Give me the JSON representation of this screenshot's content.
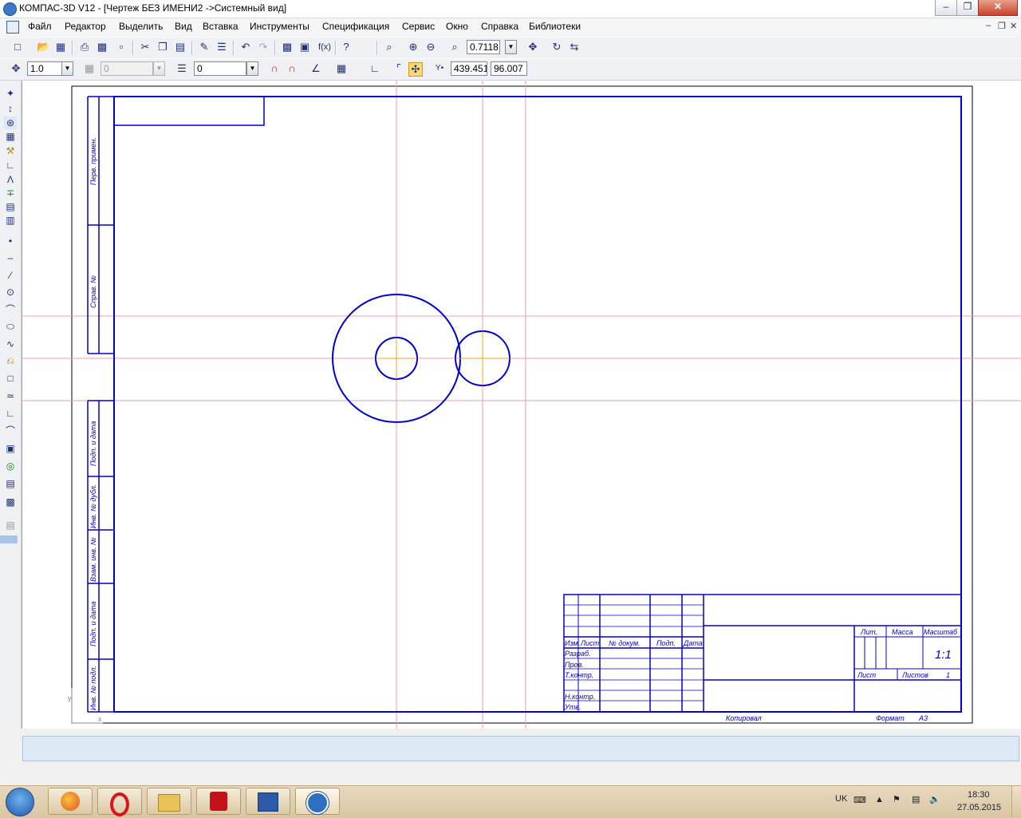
{
  "window": {
    "title": "КОМПАС-3D V12 - [Чертеж БЕЗ ИМЕНИ2 ->Системный вид]"
  },
  "menu": [
    "Файл",
    "Редактор",
    "Выделить",
    "Вид",
    "Вставка",
    "Инструменты",
    "Спецификация",
    "Сервис",
    "Окно",
    "Справка",
    "Библиотеки"
  ],
  "toolbar": {
    "zoom_value": "0.7118",
    "step_value": "1.0",
    "angle_value": "0",
    "layer_value": "0",
    "coord_x": "439.451",
    "coord_y": "96.007"
  },
  "drawing": {
    "side_labels": [
      "Перв. примен.",
      "Справ. №",
      "Подп. и дата",
      "Инв. № дубл.",
      "Взам. инв. №",
      "Подп. и дата",
      "Инв. № подл."
    ],
    "title_block": {
      "header": [
        "Изм.",
        "Лист",
        "№ докум.",
        "Подп.",
        "Дата"
      ],
      "rows": [
        "Разраб.",
        "Пров.",
        "Т.контр.",
        "",
        "Н.контр.",
        "Утв."
      ],
      "lit": "Лит.",
      "massa": "Масса",
      "masshtab": "Масштаб",
      "scale_value": "1:1",
      "list": "Лист",
      "listov": "Листов",
      "listov_value": "1",
      "copied": "Копировал",
      "format": "Формат",
      "format_value": "A3"
    }
  },
  "taskbar": {
    "lang": "UK",
    "time": "18:30",
    "date": "27.05.2015"
  },
  "colors": {
    "drawing_lines": "#0000cc",
    "axis_lines": "#e4a0a8",
    "highlight": "#f0a020"
  }
}
